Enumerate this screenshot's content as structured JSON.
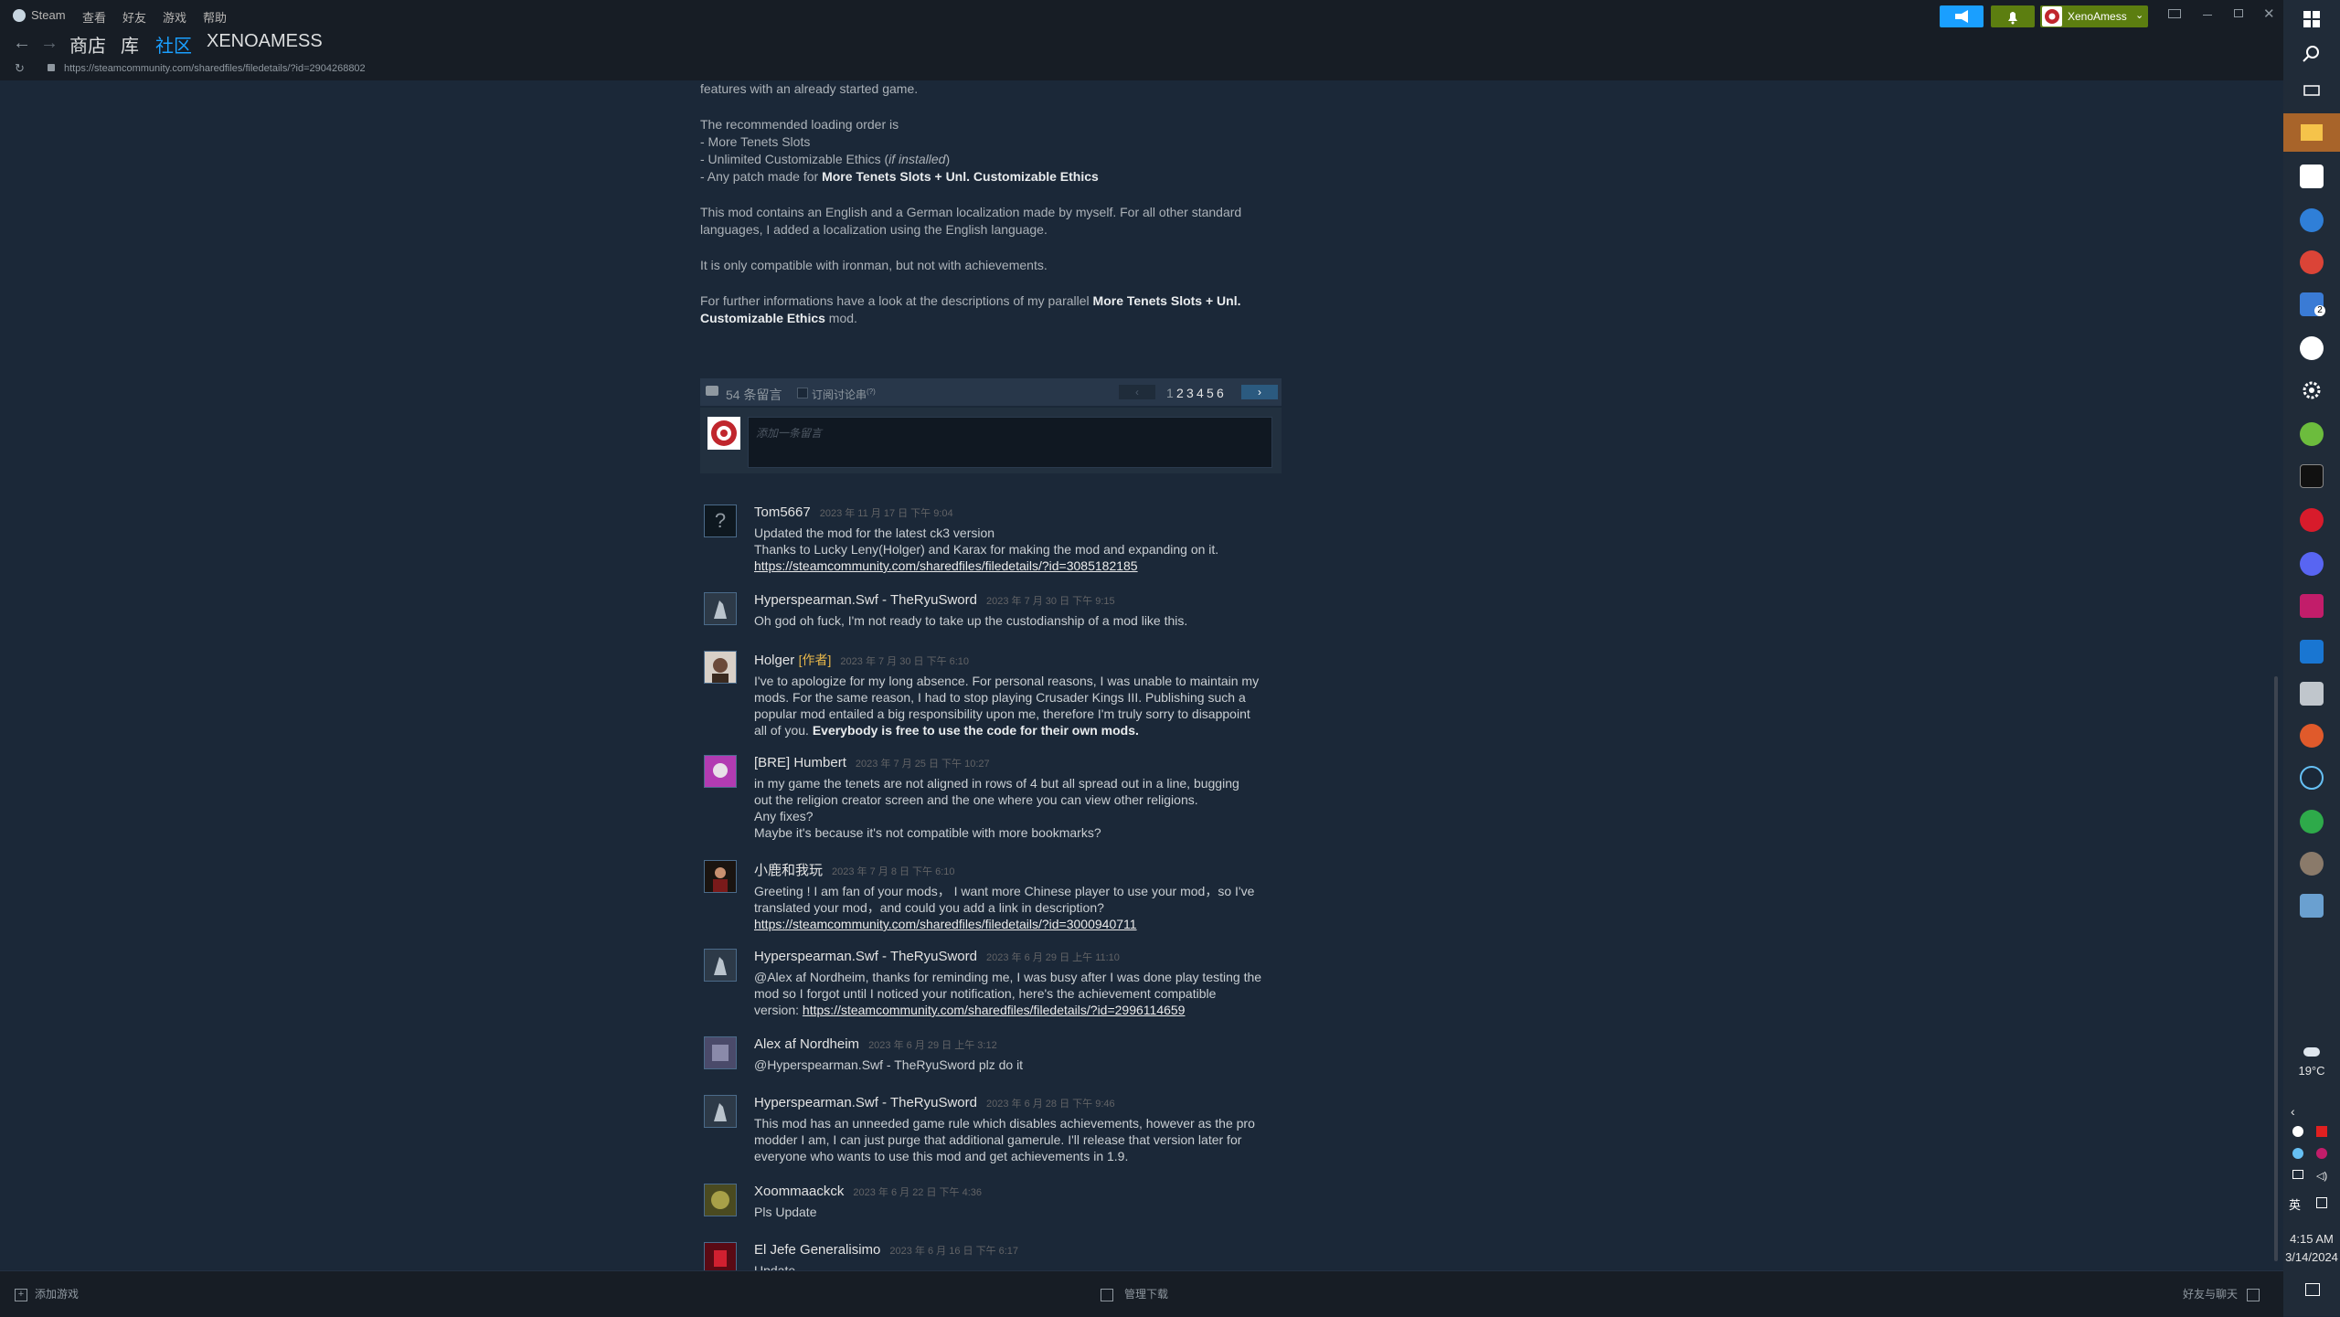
{
  "titlebar": {
    "menu": [
      "Steam",
      "查看",
      "好友",
      "游戏",
      "帮助"
    ],
    "username": "XenoAmess"
  },
  "nav": {
    "tabs": [
      "商店",
      "库",
      "社区"
    ],
    "username_title": "XENOAMESS",
    "url": "https://steamcommunity.com/sharedfiles/filedetails/?id=2904268802"
  },
  "description": {
    "line0": "features with an already started game.",
    "load_order_title": "The recommended loading order is",
    "load_order_1": "- More Tenets Slots",
    "load_order_2_pre": "- Unlimited Customizable Ethics (",
    "load_order_2_em": "if installed",
    "load_order_2_post": ")",
    "load_order_3_pre": "- Any patch made for ",
    "load_order_3_bold": "More Tenets Slots + Unl. Customizable Ethics",
    "localization_1": "This mod contains an English and a German localization made by myself. For all other standard",
    "localization_2": "languages, I added a localization using the English language.",
    "compat": "It is only compatible with ironman, but not with achievements.",
    "further_pre": "For further informations have a look at the descriptions of my parallel ",
    "further_bold_1": "More Tenets Slots + Unl.",
    "further_bold_2": "Customizable Ethics",
    "further_post": " mod."
  },
  "comments_header": {
    "count": "54 条留言",
    "subscribe": "订阅讨论串",
    "subscribe_sup": "(?)",
    "pages": [
      "1",
      "2",
      "3",
      "4",
      "5",
      "6"
    ],
    "add_placeholder": "添加一条留言"
  },
  "comments": [
    {
      "author": "Tom5667",
      "date": "2023 年 11 月 17 日 下午 9:04",
      "lines": [
        "Updated the mod for the latest ck3 version",
        "Thanks to Lucky Leny(Holger) and Karax for making the mod and expanding on it."
      ],
      "link": "https://steamcommunity.com/sharedfiles/filedetails/?id=3085182185"
    },
    {
      "author": "Hyperspearman.Swf - TheRyuSword",
      "date": "2023 年 7 月 30 日 下午 9:15",
      "lines": [
        "Oh god oh fuck, I'm not ready to take up the custodianship of a mod like this."
      ]
    },
    {
      "author": "Holger",
      "tag": "[作者]",
      "date": "2023 年 7 月 30 日 下午 6:10",
      "lines": [
        "I've to apologize for my long absence. For personal reasons, I was unable to maintain my",
        "mods. For the same reason, I had to stop playing Crusader Kings III. Publishing such a",
        "popular mod entailed a big responsibility upon me, therefore I'm truly sorry to disappoint"
      ],
      "last_pre": "all of you. ",
      "last_bold": "Everybody is free to use the code for their own mods."
    },
    {
      "author": "[BRE] Humbert",
      "date": "2023 年 7 月 25 日 下午 10:27",
      "lines": [
        "in my game the tenets are not aligned in rows of 4 but all spread out in a line, bugging",
        "out the religion creator screen and the one where you can view other religions.",
        "Any fixes?",
        "Maybe it's because it's not compatible with more bookmarks?"
      ]
    },
    {
      "author": "小鹿和我玩",
      "date": "2023 年 7 月 8 日 下午 6:10",
      "lines": [
        "Greeting ! I am fan of your mods， I want more Chinese player to use your mod，so I've",
        "translated your mod，and could you add a link in description?"
      ],
      "link": "https://steamcommunity.com/sharedfiles/filedetails/?id=3000940711"
    },
    {
      "author": "Hyperspearman.Swf - TheRyuSword",
      "date": "2023 年 6 月 29 日 上午 11:10",
      "lines": [
        "@Alex af Nordheim, thanks for reminding me, I was busy after I was done play testing the",
        "mod so I forgot until I noticed your notification, here's the achievement compatible"
      ],
      "version_pre": "version: ",
      "version_link": "https://steamcommunity.com/sharedfiles/filedetails/?id=2996114659"
    },
    {
      "author": "Alex af Nordheim",
      "date": "2023 年 6 月 29 日 上午 3:12",
      "lines": [
        "@Hyperspearman.Swf - TheRyuSword plz do it"
      ]
    },
    {
      "author": "Hyperspearman.Swf - TheRyuSword",
      "date": "2023 年 6 月 28 日 下午 9:46",
      "lines": [
        "This mod has an unneeded game rule which disables achievements, however as the pro",
        "modder I am, I can just purge that additional gamerule. I'll release that version later for",
        "everyone who wants to use this mod and get achievements in 1.9."
      ]
    },
    {
      "author": "Xoommaackck",
      "date": "2023 年 6 月 22 日 下午 4:36",
      "lines": [
        "Pls Update"
      ]
    },
    {
      "author": "El Jefe Generalisimo",
      "date": "2023 年 6 月 16 日 下午 6:17",
      "lines": [
        "Update"
      ]
    }
  ],
  "bottombar": {
    "add_game": "添加游戏",
    "manage_downloads": "管理下载",
    "friends_chat": "好友与聊天"
  },
  "taskbar": {
    "weather": "19°C",
    "lang": "英",
    "time": "4:15 AM",
    "date": "3/14/2024",
    "badge": "2"
  },
  "colors": {
    "accent": "#1a9fff",
    "green": "#5c7e10",
    "link": "#66c0f4"
  }
}
